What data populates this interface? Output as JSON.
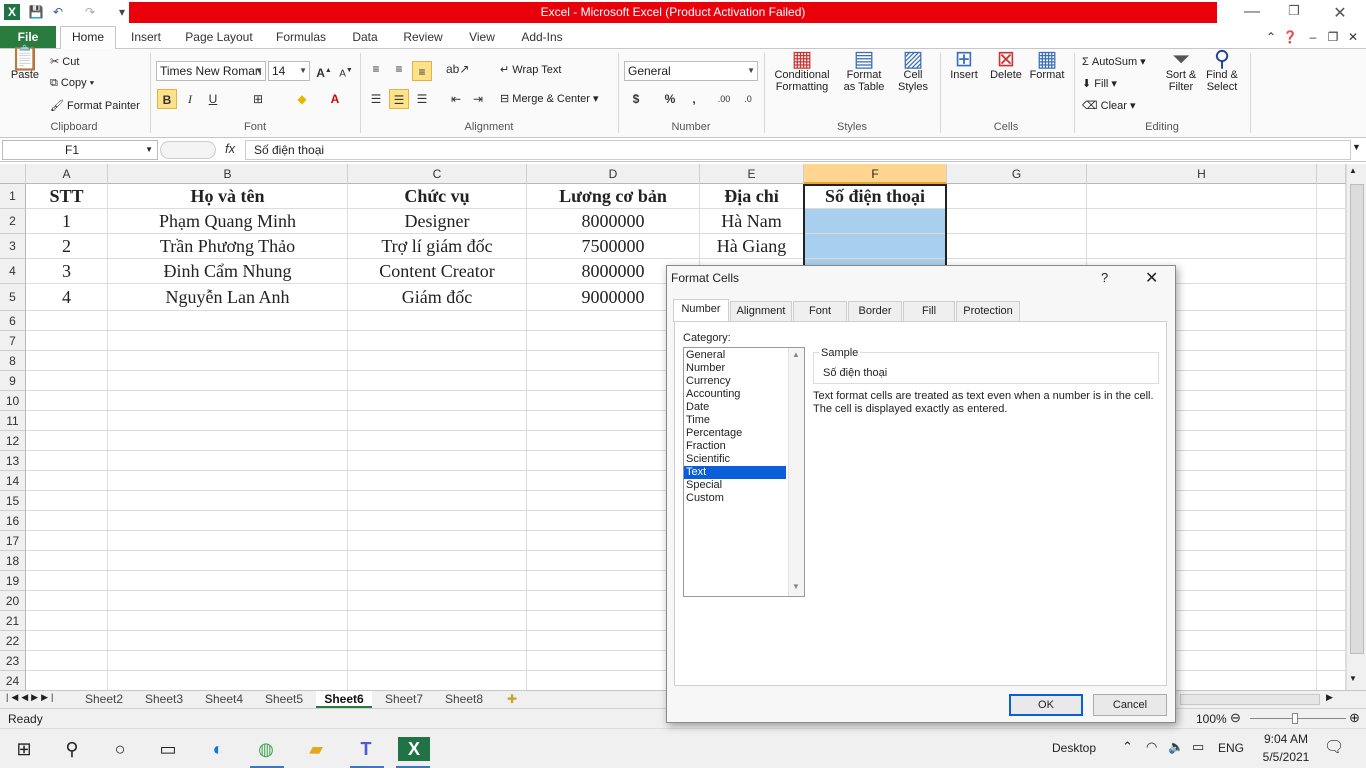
{
  "window": {
    "title": "Excel - Microsoft Excel (Product Activation Failed)"
  },
  "ribbon_tabs": [
    "File",
    "Home",
    "Insert",
    "Page Layout",
    "Formulas",
    "Data",
    "Review",
    "View",
    "Add-Ins"
  ],
  "clipboard": {
    "paste": "Paste",
    "cut": "Cut",
    "copy": "Copy",
    "format_painter": "Format Painter",
    "label": "Clipboard"
  },
  "font": {
    "name": "Times New Roman",
    "size": "14",
    "bold": "B",
    "italic": "I",
    "underline": "U",
    "label": "Font"
  },
  "alignment": {
    "wrap": "Wrap Text",
    "merge": "Merge & Center",
    "label": "Alignment"
  },
  "number": {
    "format": "General",
    "currency": "$",
    "percent": "%",
    "comma": ",",
    "label": "Number"
  },
  "styles": {
    "conditional": "Conditional",
    "conditional2": "Formatting",
    "format_table": "Format",
    "format_table2": "as Table",
    "cell_styles": "Cell",
    "cell_styles2": "Styles",
    "label": "Styles"
  },
  "cells": {
    "insert": "Insert",
    "delete": "Delete",
    "format": "Format",
    "label": "Cells"
  },
  "editing": {
    "autosum": "AutoSum",
    "fill": "Fill",
    "clear": "Clear",
    "sort": "Sort &",
    "sort2": "Filter",
    "find": "Find &",
    "find2": "Select",
    "label": "Editing"
  },
  "formula_bar": {
    "name_box": "F1",
    "fx": "fx",
    "content": "Số điện thoại"
  },
  "columns": [
    "A",
    "B",
    "C",
    "D",
    "E",
    "F",
    "G",
    "H"
  ],
  "rows": [
    "1",
    "2",
    "3",
    "4",
    "5",
    "6",
    "7",
    "8",
    "9",
    "10",
    "11",
    "12",
    "13",
    "14",
    "15",
    "16",
    "17",
    "18",
    "19",
    "20",
    "21",
    "22",
    "23",
    "24"
  ],
  "table": {
    "header": [
      "STT",
      "Họ và tên",
      "Chức vụ",
      "Lương cơ bản",
      "Địa chỉ",
      "Số điện thoại"
    ],
    "rows": [
      [
        "1",
        "Phạm Quang Minh",
        "Designer",
        "8000000",
        "Hà Nam",
        ""
      ],
      [
        "2",
        "Trần Phương Thảo",
        "Trợ lí giám đốc",
        "7500000",
        "Hà Giang",
        ""
      ],
      [
        "3",
        "Đinh Cẩm Nhung",
        "Content Creator",
        "8000000",
        "",
        ""
      ],
      [
        "4",
        "Nguyễn Lan Anh",
        "Giám đốc",
        "9000000",
        "",
        ""
      ]
    ]
  },
  "sheets": [
    "Sheet2",
    "Sheet3",
    "Sheet4",
    "Sheet5",
    "Sheet6",
    "Sheet7",
    "Sheet8"
  ],
  "status": {
    "ready": "Ready",
    "zoom": "100%"
  },
  "dialog": {
    "title": "Format Cells",
    "help": "?",
    "tabs": [
      "Number",
      "Alignment",
      "Font",
      "Border",
      "Fill",
      "Protection"
    ],
    "category_label": "Category:",
    "categories": [
      "General",
      "Number",
      "Currency",
      "Accounting",
      "Date",
      "Time",
      "Percentage",
      "Fraction",
      "Scientific",
      "Text",
      "Special",
      "Custom"
    ],
    "selected_category": "Text",
    "sample_label": "Sample",
    "sample_value": "Số điện thoại",
    "description_1": "Text format cells are treated as text even when a number is in the cell.",
    "description_2": "The cell is displayed exactly as entered.",
    "ok": "OK",
    "cancel": "Cancel"
  },
  "taskbar": {
    "desktop": "Desktop",
    "lang": "ENG",
    "time": "9:04 AM",
    "date": "5/5/2021"
  }
}
